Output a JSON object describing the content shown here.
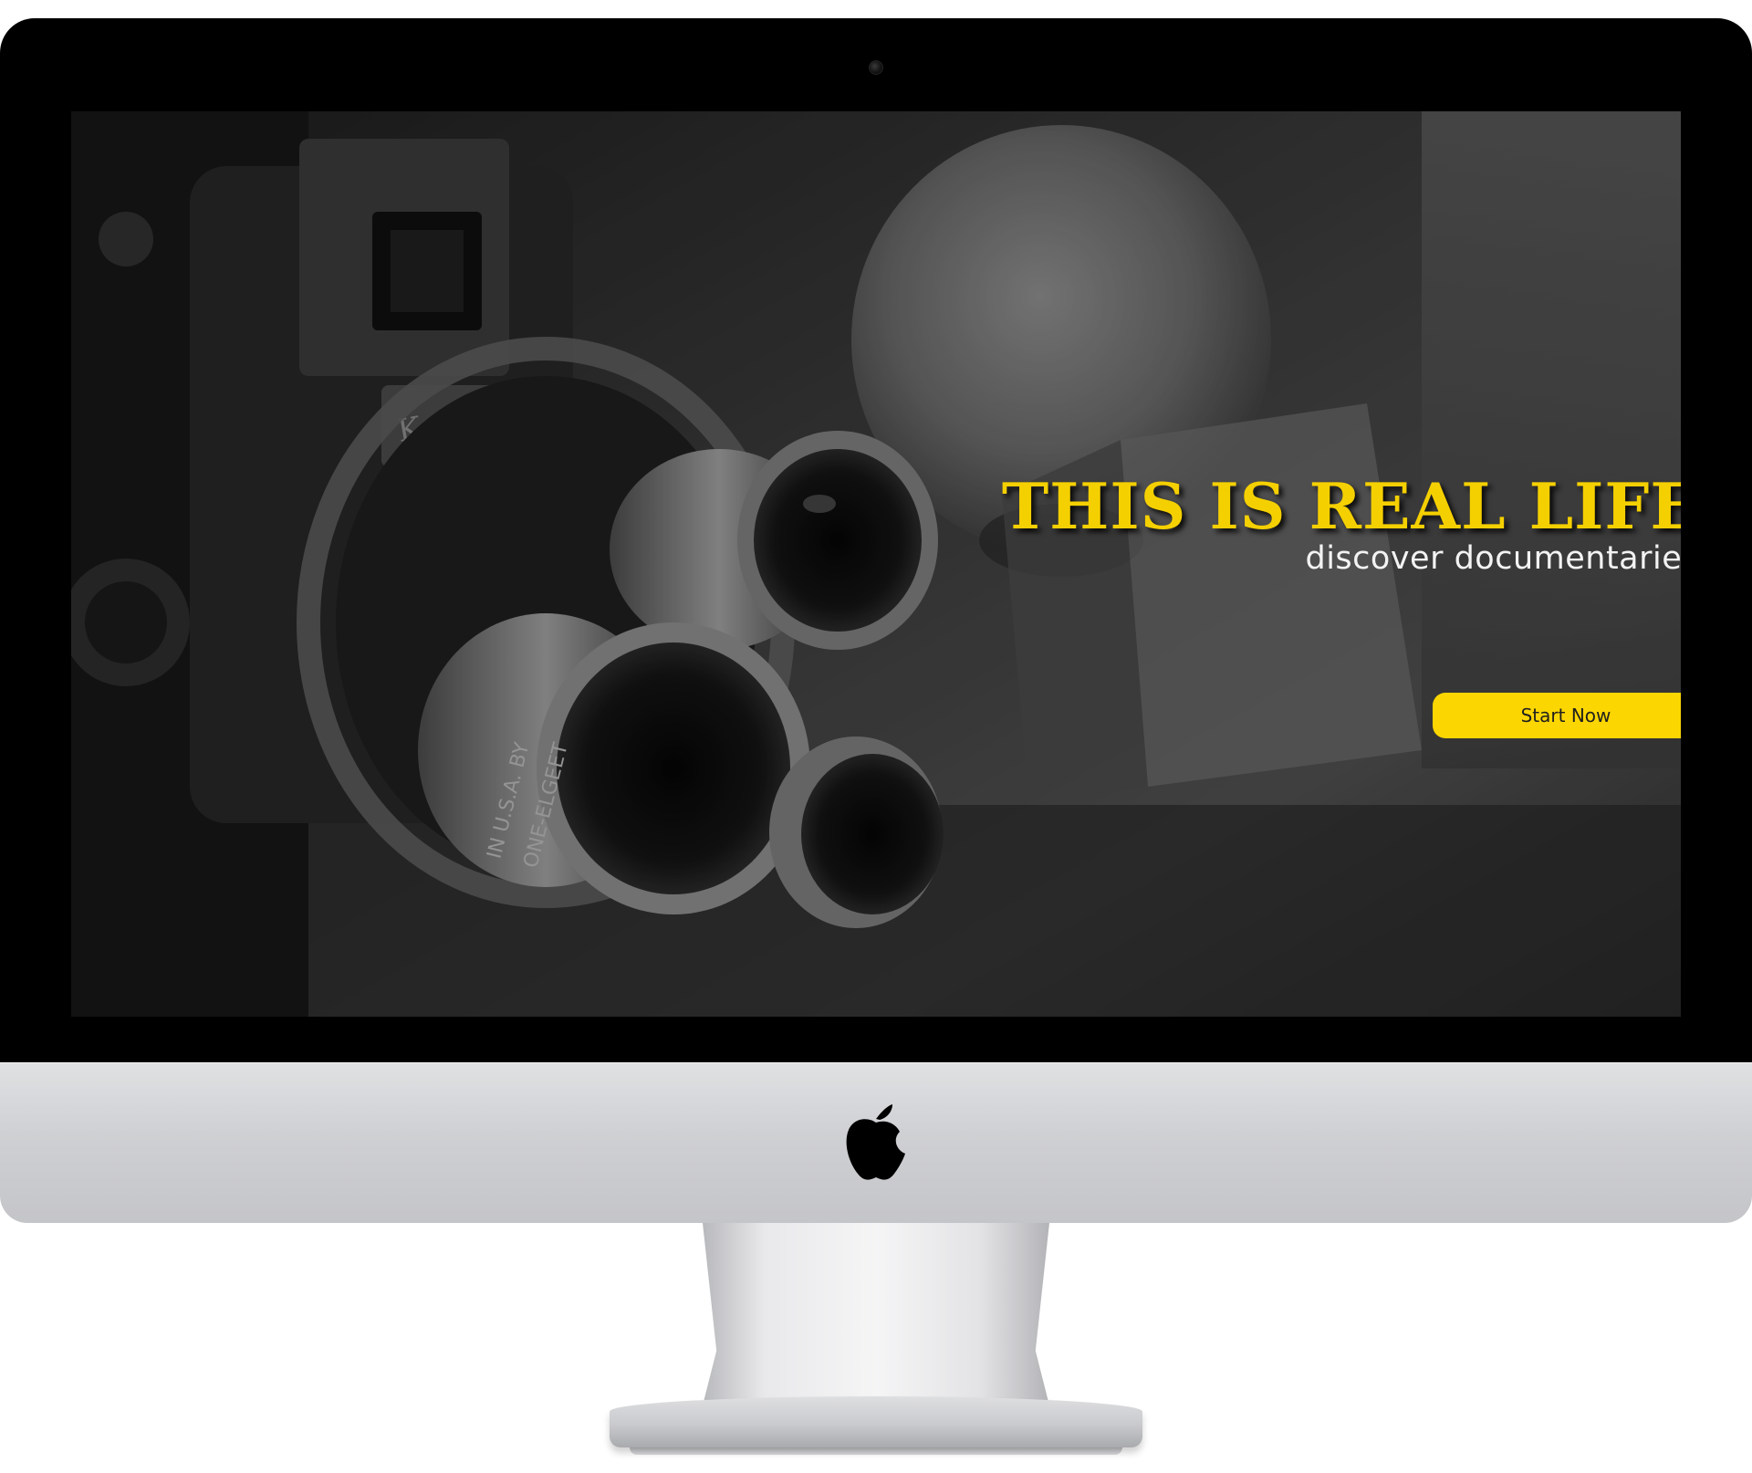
{
  "device": {
    "logo_icon": "apple-logo-icon",
    "camera_icon": "webcam-icon"
  },
  "hero": {
    "title": "THIS IS REAL LIFE",
    "subtitle": "discover documentaries",
    "cta_label": "Start Now",
    "background_image": "vintage-movie-camera-photo"
  },
  "colors": {
    "accent": "#fcd600",
    "title_yellow": "#f5d000",
    "subtitle_white": "#f3f3f3",
    "bezel_black": "#000000",
    "chin_silver": "#cfd0d3"
  }
}
